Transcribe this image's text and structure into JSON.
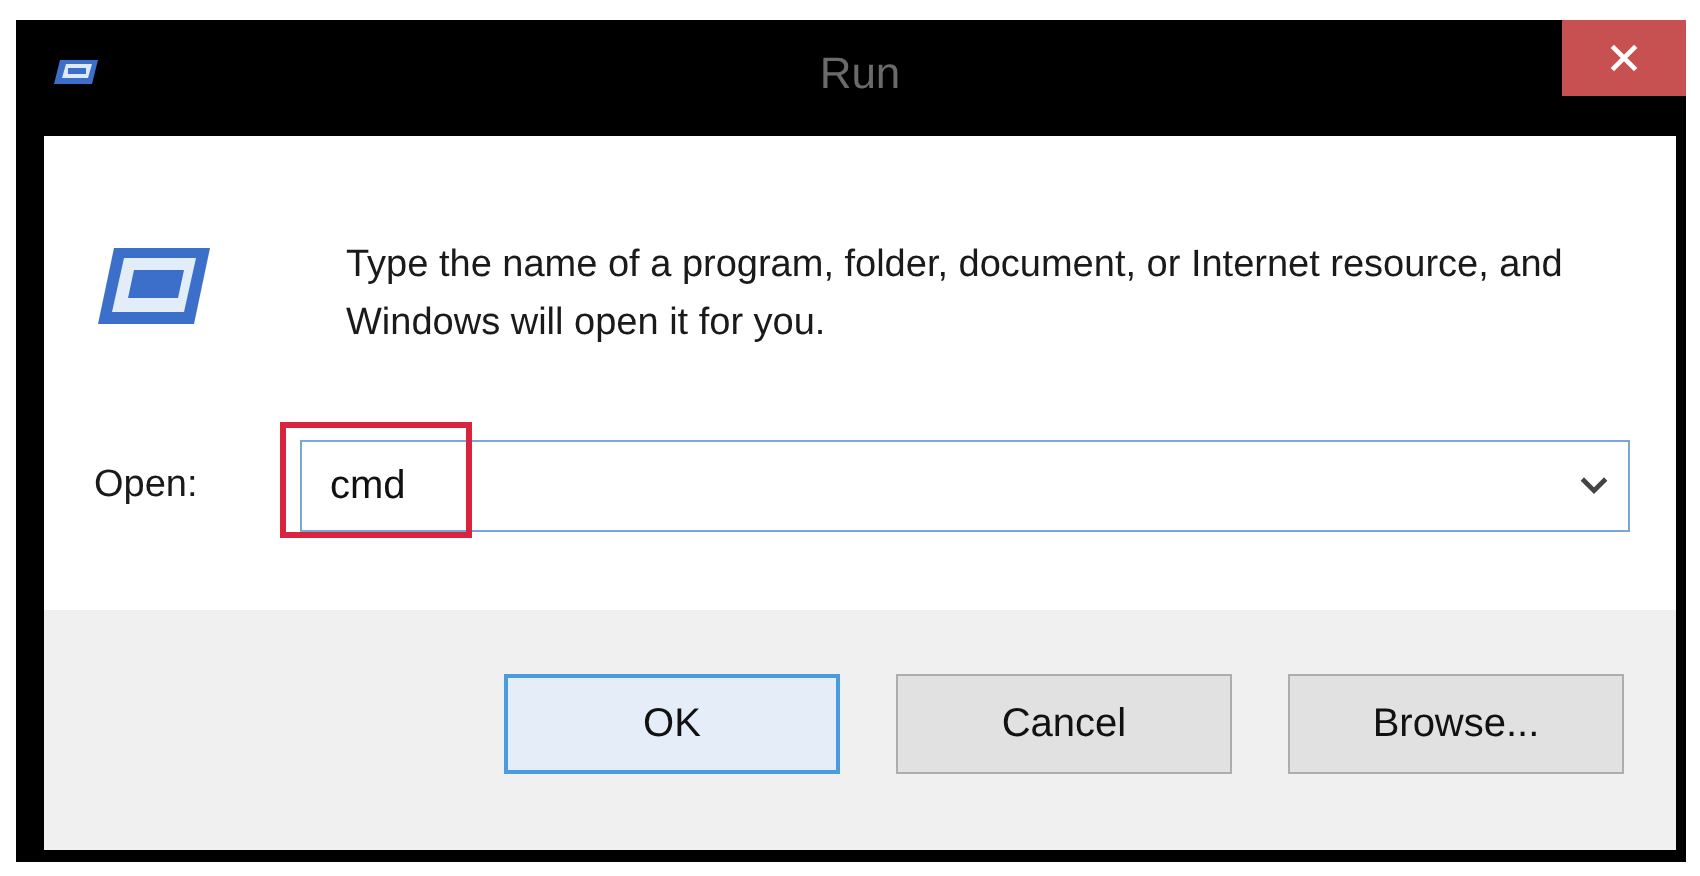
{
  "window": {
    "title": "Run"
  },
  "message": "Type the name of a program, folder, document, or Internet resource, and Windows will open it for you.",
  "open_field": {
    "label": "Open:",
    "value": "cmd",
    "highlighted": true
  },
  "buttons": [
    {
      "label": "OK",
      "default": true
    },
    {
      "label": "Cancel",
      "default": false
    },
    {
      "label": "Browse...",
      "default": false
    }
  ]
}
